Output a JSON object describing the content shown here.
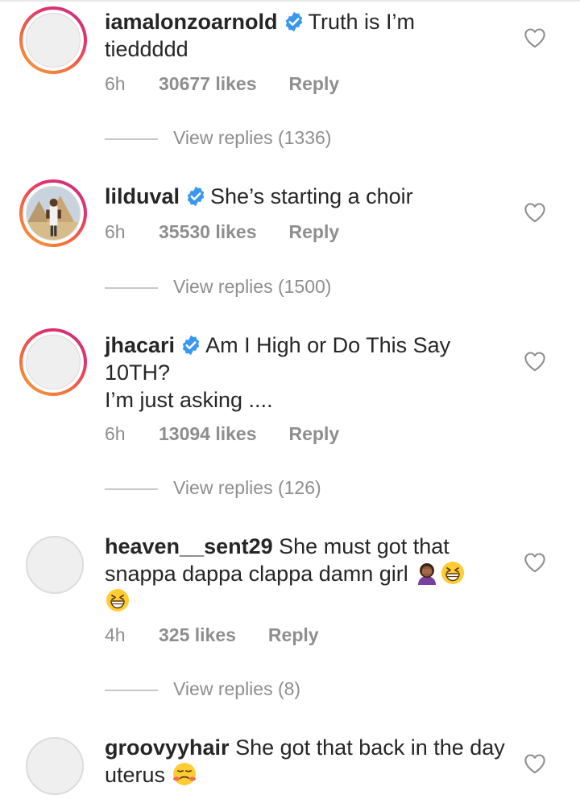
{
  "comments": [
    {
      "username": "iamalonzoarnold",
      "verified": true,
      "text_line1": "Truth is I’m",
      "text_line2": "tieddddd",
      "time": "6h",
      "likes": "30677 likes",
      "reply": "Reply",
      "view_replies": "View replies (1336)",
      "avatar_style": "story-ring"
    },
    {
      "username": "lilduval",
      "verified": true,
      "text_line1": "She’s starting a choir",
      "time": "6h",
      "likes": "35530 likes",
      "reply": "Reply",
      "view_replies": "View replies (1500)",
      "avatar_style": "story-ring-photo"
    },
    {
      "username": "jhacari",
      "verified": true,
      "text_line1": "Am I High or Do This Say",
      "text_line2": "10TH?",
      "text_line3": "I’m just asking ....",
      "time": "6h",
      "likes": "13094 likes",
      "reply": "Reply",
      "view_replies": "View replies (126)",
      "avatar_style": "story-ring"
    },
    {
      "username": "heaven__sent29",
      "verified": false,
      "text_line1": "She must got that",
      "text_line2": "snappa dappa clappa  damn girl",
      "emojis": [
        "woman-facepalming-emoji",
        "grinning-squinting-emoji",
        "grinning-squinting-emoji"
      ],
      "time": "4h",
      "likes": "325 likes",
      "reply": "Reply",
      "view_replies": "View replies (8)",
      "avatar_style": "plain"
    },
    {
      "username": "groovyyhair",
      "verified": false,
      "text_line1": "She got that back in the day",
      "text_line2": "uterus",
      "emojis": [
        "face-with-steam-emoji"
      ],
      "avatar_style": "plain"
    }
  ],
  "icons": {
    "verified": "verified-badge-icon",
    "like": "heart-outline-icon"
  },
  "colors": {
    "verified_blue": "#3897f0",
    "meta_gray": "#8e8e8e",
    "text_dark": "#262626",
    "ring_gradient": [
      "#f9a13a",
      "#e4306c",
      "#c13584"
    ],
    "emoji_yellow": "#ffcc33"
  }
}
